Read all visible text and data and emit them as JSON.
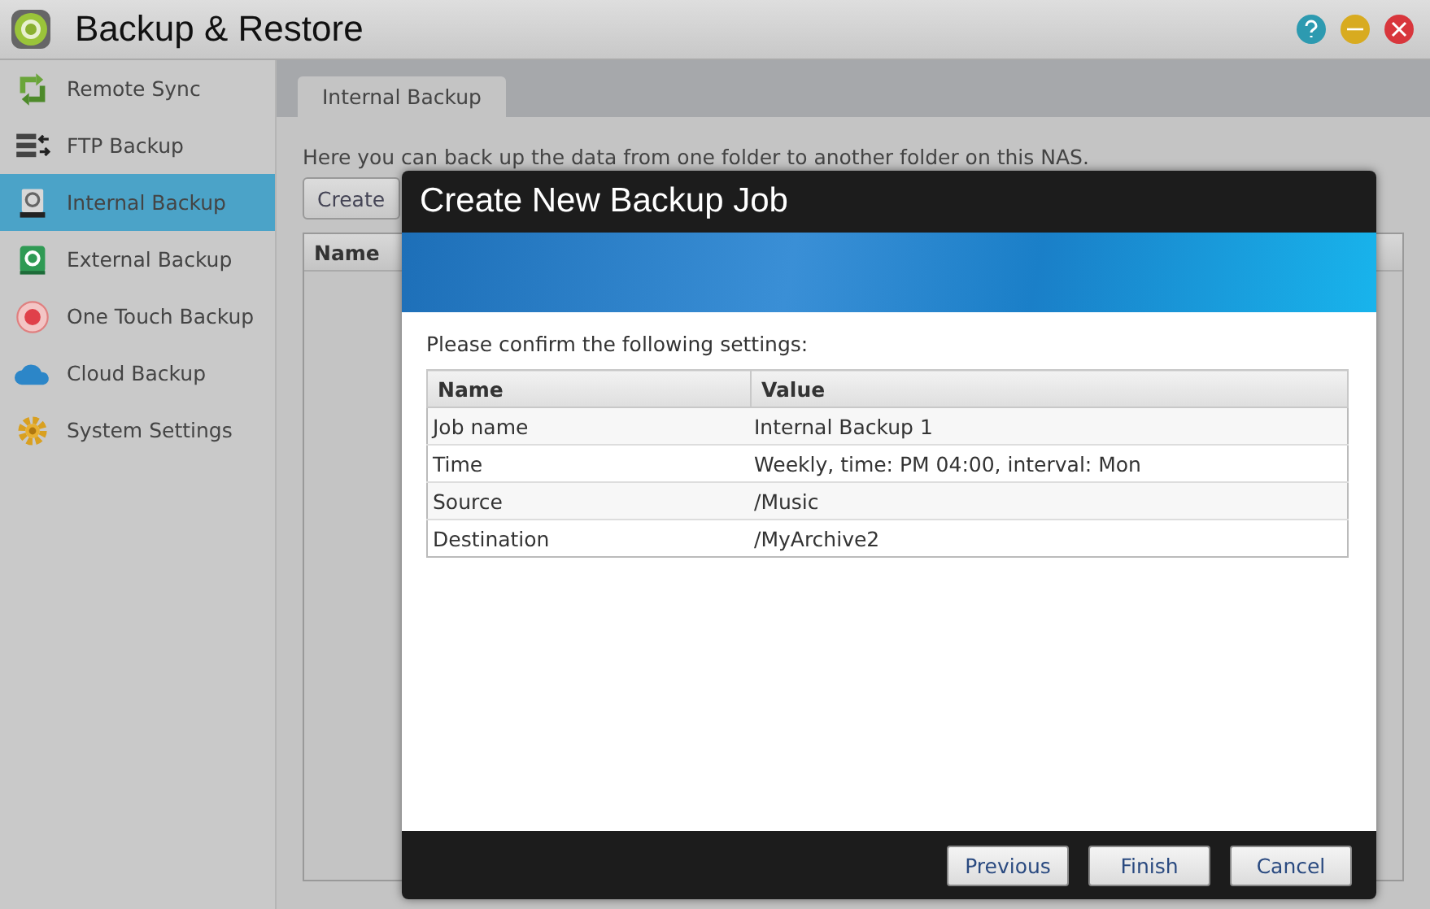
{
  "window": {
    "title": "Backup & Restore"
  },
  "sidebar": {
    "items": [
      {
        "label": "Remote Sync",
        "kind": "sync",
        "selected": false
      },
      {
        "label": "FTP Backup",
        "kind": "ftp",
        "selected": false
      },
      {
        "label": "Internal Backup",
        "kind": "internal",
        "selected": true
      },
      {
        "label": "External Backup",
        "kind": "external",
        "selected": false
      },
      {
        "label": "One Touch Backup",
        "kind": "onetouch",
        "selected": false
      },
      {
        "label": "Cloud Backup",
        "kind": "cloud",
        "selected": false
      },
      {
        "label": "System Settings",
        "kind": "settings",
        "selected": false
      }
    ]
  },
  "tabs": [
    {
      "label": "Internal Backup",
      "selected": true
    }
  ],
  "description": "Here you can back up the data from one folder to another folder on this NAS.",
  "toolbar": {
    "buttons": [
      "Create"
    ]
  },
  "table": {
    "columns": [
      "Name"
    ]
  },
  "dialog": {
    "title": "Create New Backup Job",
    "prompt": "Please confirm the following settings:",
    "columns": [
      "Name",
      "Value"
    ],
    "rows": [
      [
        "Job name",
        "Internal Backup 1"
      ],
      [
        "Time",
        "Weekly, time: PM 04:00, interval: Mon"
      ],
      [
        "Source",
        "/Music"
      ],
      [
        "Destination",
        "/MyArchive2"
      ]
    ],
    "buttons": [
      "Previous",
      "Finish",
      "Cancel"
    ]
  }
}
